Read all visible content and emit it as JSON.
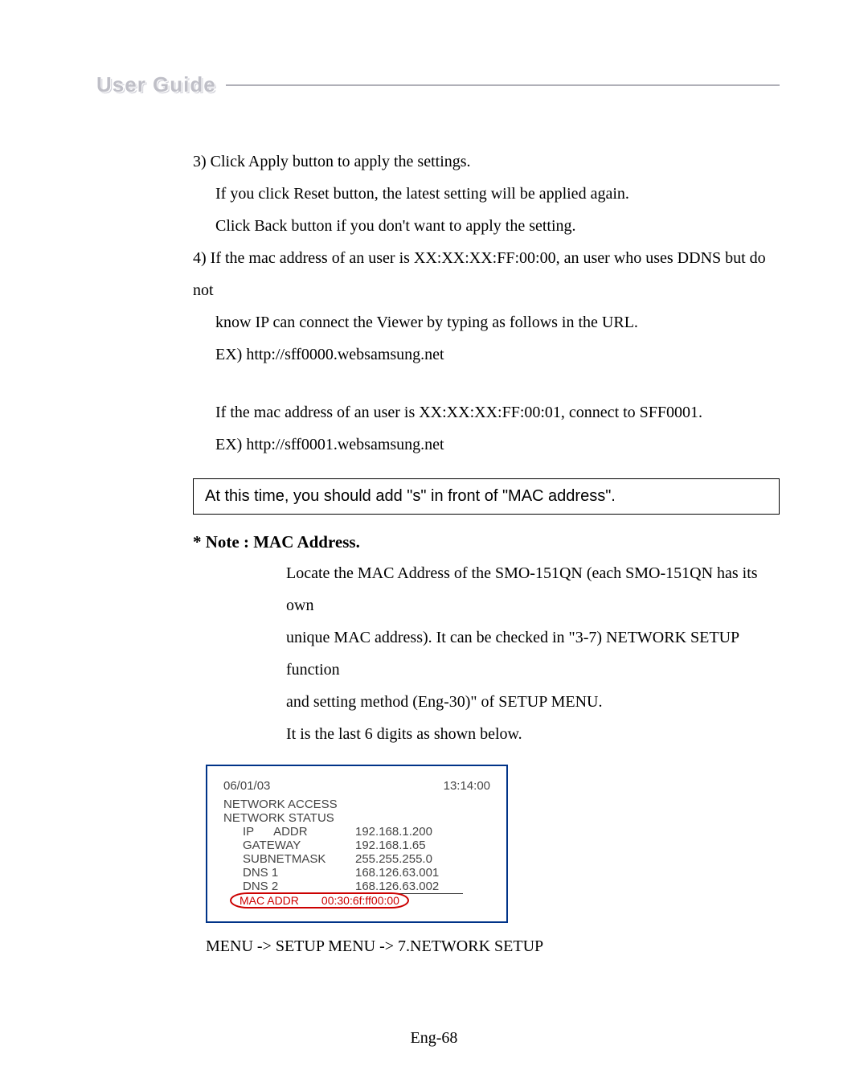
{
  "header": {
    "title": "User Guide"
  },
  "para": {
    "p3": "3) Click Apply button to apply the settings.",
    "p3a": "If you click Reset button, the latest setting will be applied again.",
    "p3b": "Click Back button if you don't want to apply the setting.",
    "p4": "4) If the mac address of an user is XX:XX:XX:FF:00:00, an user who uses DDNS but do not",
    "p4a": "know IP can connect the Viewer by typing as follows in the URL.",
    "p4b": "EX) http://sff0000.websamsung.net",
    "p5": "If the mac address of an user is XX:XX:XX:FF:00:01, connect to SFF0001.",
    "p5a": "EX) http://sff0001.websamsung.net"
  },
  "callout": "At this time, you should add \"s\" in front of \"MAC address\".",
  "note": {
    "heading": "* Note : MAC Address.",
    "l1": "Locate the MAC Address of the SMO-151QN (each SMO-151QN has its own",
    "l2": "unique MAC address). It can be checked in \"3-7) NETWORK SETUP function",
    "l3": "and setting method (Eng-30)\" of SETUP MENU.",
    "l4": "It is the last 6 digits as shown below."
  },
  "panel": {
    "date": "06/01/03",
    "time": "13:14:00",
    "t1": "NETWORK ACCESS",
    "t2": "NETWORK STATUS",
    "rows": {
      "ip_k": "IP      ADDR",
      "ip_v": "192.168.1.200",
      "gw_k": "GATEWAY",
      "gw_v": "192.168.1.65",
      "sm_k": "SUBNETMASK",
      "sm_v": "255.255.255.0",
      "d1_k": "DNS 1",
      "d1_v": "168.126.63.001",
      "d2_k": "DNS 2",
      "d2_v": "168.126.63.002"
    },
    "mac_k": "MAC ADDR",
    "mac_v": "00:30:6f:ff00:00"
  },
  "menu_path": "MENU -> SETUP MENU -> 7.NETWORK SETUP",
  "page_number": "Eng-68"
}
